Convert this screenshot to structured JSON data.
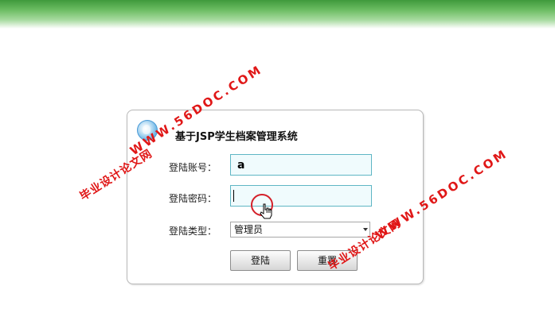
{
  "header": {
    "system_title": "基于JSP学生档案管理系统"
  },
  "form": {
    "account_label": "登陆账号：",
    "account_value": "a",
    "password_label": "登陆密码：",
    "password_value": "",
    "type_label": "登陆类型：",
    "type_selected": "管理员",
    "login_button": "登陆",
    "reset_button": "重置"
  },
  "watermarks": {
    "left_chinese": "毕业设计论文网",
    "left_url": "WWW.56DOC.COM",
    "right_chinese": "毕业设计论文网",
    "right_url": "WWW.56DOC.COM"
  },
  "colors": {
    "header_green": "#3f9a3c",
    "input_border": "#5fb6c4",
    "input_background": "#f0fbfd",
    "watermark_red": "#e01717"
  },
  "icons": {
    "logo": "blue-orb-icon",
    "select_arrow": "chevron-down-icon",
    "cursor": "hand-pointer-icon"
  }
}
